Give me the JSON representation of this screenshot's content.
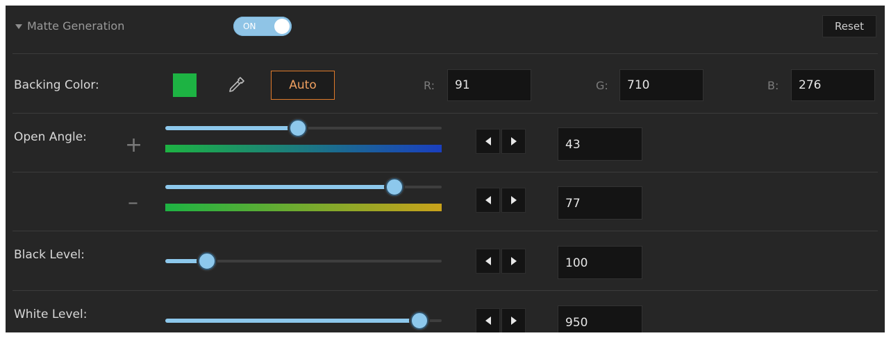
{
  "header": {
    "section_title": "Matte Generation",
    "toggle_label": "ON",
    "toggle_state": true,
    "reset_label": "Reset"
  },
  "backing_color": {
    "label": "Backing Color:",
    "swatch_color": "#1db343",
    "eyedropper_icon": "eyedropper-icon",
    "auto_label": "Auto",
    "r_label": "R:",
    "r_value": "91",
    "g_label": "G:",
    "g_value": "710",
    "b_label": "B:",
    "b_value": "276"
  },
  "open_angle": {
    "label": "Open Angle:",
    "plus": {
      "sign": "+",
      "value": "43",
      "level": 0.48,
      "gradient": [
        "#1db343",
        "#1a3fbf"
      ]
    },
    "minus": {
      "sign": "–",
      "value": "77",
      "level": 0.83,
      "gradient": [
        "#1db343",
        "#c9a21a"
      ]
    }
  },
  "black_level": {
    "label": "Black Level:",
    "value": "100",
    "level": 0.15
  },
  "white_level": {
    "label": "White Level:",
    "value": "950",
    "level": 0.92
  },
  "colors": {
    "panel_bg": "#262626",
    "accent_blue": "#8dc8ec",
    "auto_orange": "#e07a2a"
  }
}
